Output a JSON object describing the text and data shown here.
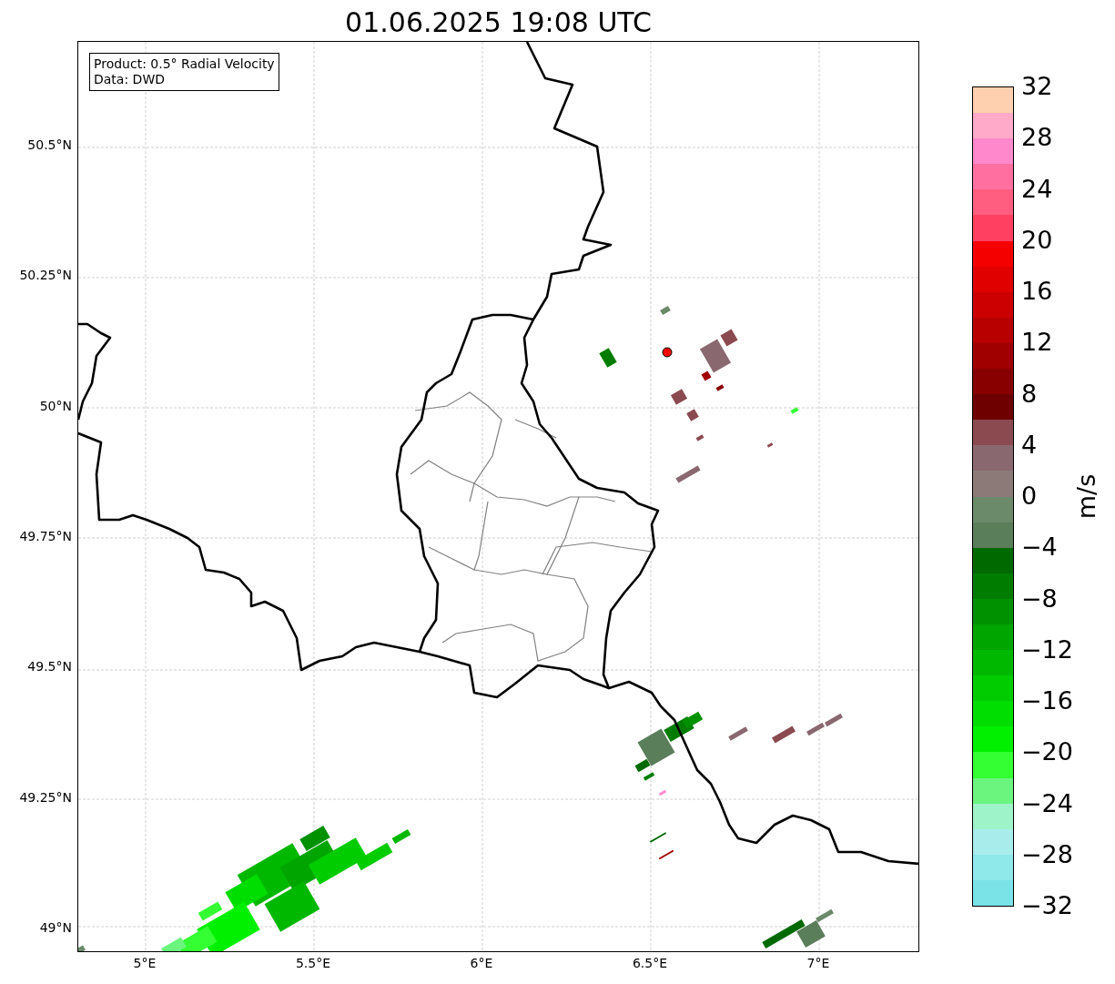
{
  "title": "01.06.2025 19:08 UTC",
  "legend": {
    "lines": [
      "Product: 0.5° Radial Velocity",
      "Data: DWD"
    ]
  },
  "map": {
    "x_ticks": [
      "5°E",
      "5.5°E",
      "6°E",
      "6.5°E",
      "7°E"
    ],
    "y_ticks": [
      "50.5°N",
      "50.25°N",
      "50°N",
      "49.75°N",
      "49.5°N",
      "49.25°N",
      "49°N"
    ]
  },
  "colorbar": {
    "label": "m/s",
    "ticks": [
      "32",
      "28",
      "24",
      "20",
      "16",
      "12",
      "8",
      "4",
      "0",
      "−4",
      "−8",
      "−12",
      "−16",
      "−20",
      "−24",
      "−28",
      "−32"
    ],
    "segments": [
      {
        "color": "#ffd0b0"
      },
      {
        "color": "#ffaac8"
      },
      {
        "color": "#ff88cc"
      },
      {
        "color": "#ff70a0"
      },
      {
        "color": "#ff5e80"
      },
      {
        "color": "#ff4060"
      },
      {
        "color": "#f50000"
      },
      {
        "color": "#e00000"
      },
      {
        "color": "#cc0000"
      },
      {
        "color": "#b80000"
      },
      {
        "color": "#a00000"
      },
      {
        "color": "#880000"
      },
      {
        "color": "#6e0000"
      },
      {
        "color": "#8a4a50"
      },
      {
        "color": "#8a6870"
      },
      {
        "color": "#8c7a78"
      },
      {
        "color": "#6a8a6a"
      },
      {
        "color": "#5a7d5a"
      },
      {
        "color": "#006900"
      },
      {
        "color": "#007d00"
      },
      {
        "color": "#009100"
      },
      {
        "color": "#00a500"
      },
      {
        "color": "#00b800"
      },
      {
        "color": "#00cc00"
      },
      {
        "color": "#00dd00"
      },
      {
        "color": "#00f000"
      },
      {
        "color": "#33ff33"
      },
      {
        "color": "#6bf57f"
      },
      {
        "color": "#9ff3c9"
      },
      {
        "color": "#a9ecec"
      },
      {
        "color": "#8fe8ea"
      },
      {
        "color": "#7ae3e8"
      }
    ]
  }
}
